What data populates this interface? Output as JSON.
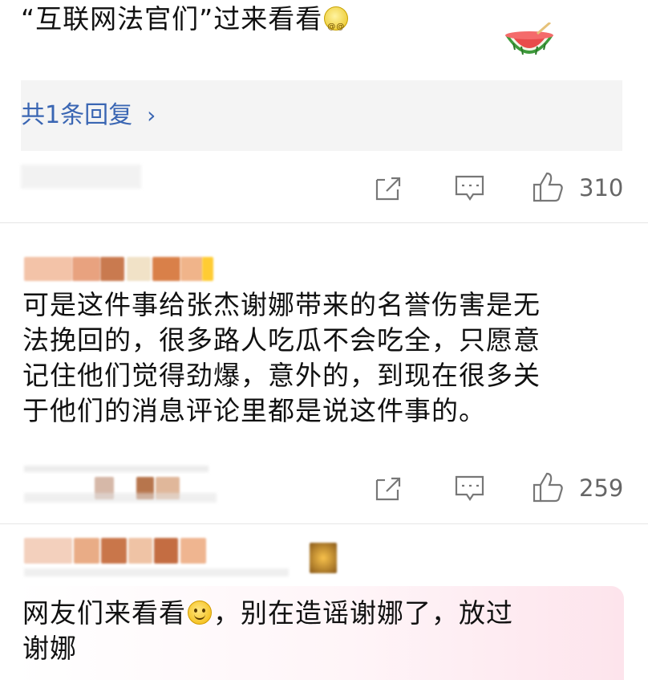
{
  "comment1": {
    "text": "“互联网法官们”过来看看",
    "reply_link": "共1条回复",
    "likes": "310"
  },
  "comment2": {
    "lines": [
      "可是这件事给张杰谢娜带来的名誉伤害是无",
      "法挽回的，很多路人吃瓜不会吃全，只愿意",
      "记住他们觉得劲爆，意外的，到现在很多关",
      "于他们的消息评论里都是说这件事的。"
    ],
    "likes": "259"
  },
  "comment3": {
    "line1_before": "网友们来看看",
    "line1_after": "，别在造谣谢娜了，放过",
    "line2": "谢娜"
  },
  "icons": [
    "share-icon",
    "comment-icon",
    "like-icon",
    "watermelon-sticker",
    "smile-emoji",
    "dizzy-emoji"
  ],
  "colors": {
    "link": "#3a66b3",
    "muted": "#777777",
    "reply_bg": "#f4f4f4"
  }
}
